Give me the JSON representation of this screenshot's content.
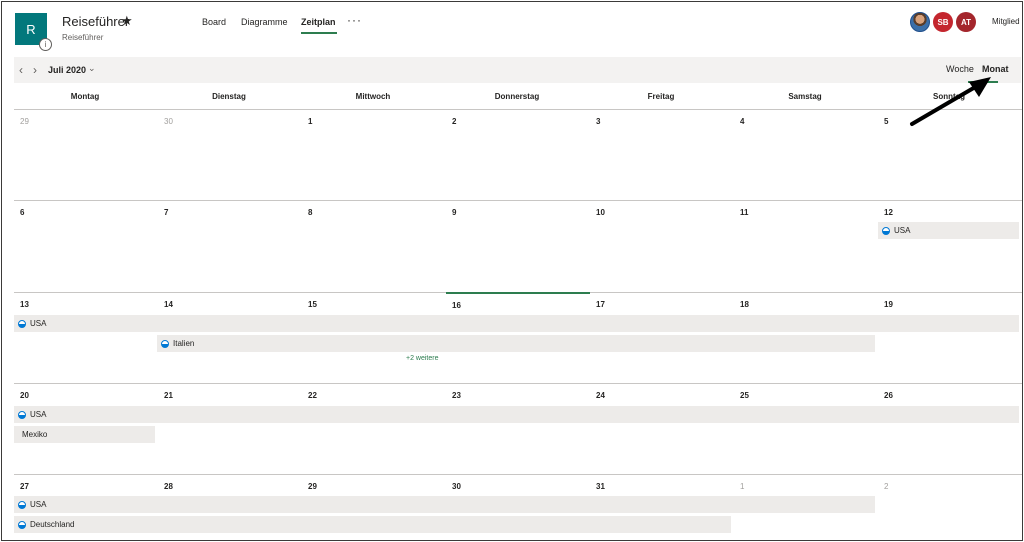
{
  "plan": {
    "tile_letter": "R",
    "info_icon": "i",
    "title": "Reiseführer",
    "star_icon": "★",
    "subtitle": "Reiseführer"
  },
  "nav": {
    "tabs": [
      "Board",
      "Diagramme",
      "Zeitplan"
    ],
    "active_tab": "Zeitplan",
    "more": "···"
  },
  "members": {
    "avatars": [
      "SB",
      "AT"
    ],
    "label": "Mitglied"
  },
  "toolbar": {
    "prev_icon": "‹",
    "next_icon": "›",
    "month": "Juli 2020",
    "month_chevron": "⌄",
    "view_week": "Woche",
    "view_month": "Monat",
    "active_view": "Monat"
  },
  "calendar": {
    "day_headers": [
      "Montag",
      "Dienstag",
      "Mittwoch",
      "Donnerstag",
      "Freitag",
      "Samstag",
      "Sonntag"
    ],
    "weeks": [
      [
        "29",
        "30",
        "1",
        "2",
        "3",
        "4",
        "5"
      ],
      [
        "6",
        "7",
        "8",
        "9",
        "10",
        "11",
        "12"
      ],
      [
        "13",
        "14",
        "15",
        "16",
        "17",
        "18",
        "19"
      ],
      [
        "20",
        "21",
        "22",
        "23",
        "24",
        "25",
        "26"
      ],
      [
        "27",
        "28",
        "29",
        "30",
        "31",
        "1",
        "2"
      ]
    ],
    "today": "16",
    "events": {
      "w2_usa": "USA",
      "w3_usa": "USA",
      "w3_italien": "Italien",
      "w3_more": "+2 weitere",
      "w4_usa": "USA",
      "w4_mexiko": "Mexiko",
      "w5_usa": "USA",
      "w5_deutschland": "Deutschland"
    }
  },
  "colors": {
    "accent": "#2d7d4f",
    "plan_tile": "#03787c",
    "event_bar": "#edebe9"
  }
}
